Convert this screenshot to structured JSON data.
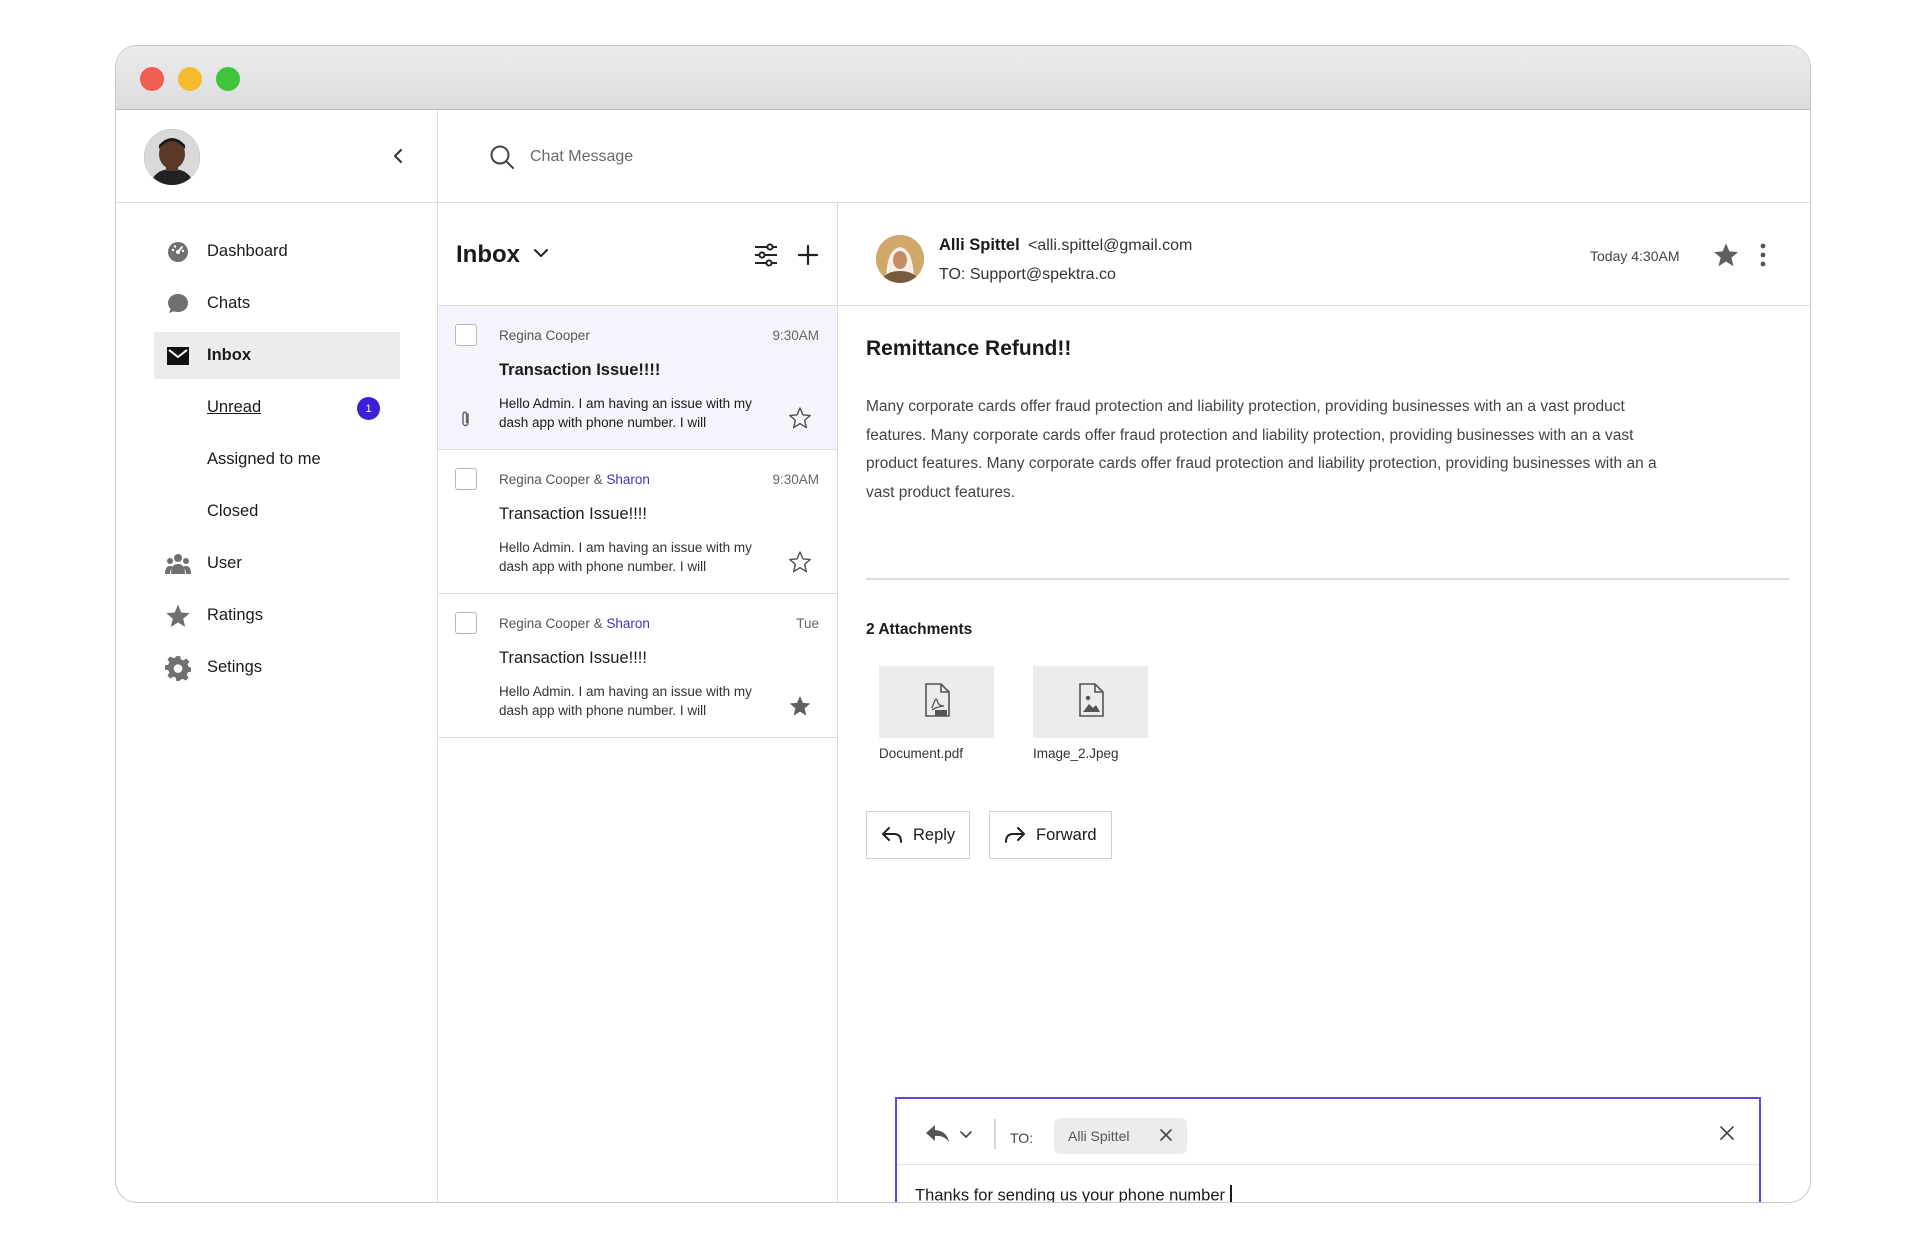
{
  "search": {
    "placeholder": "Chat Message"
  },
  "sidebar": {
    "items": [
      {
        "label": "Dashboard",
        "icon": "dashboard-icon"
      },
      {
        "label": "Chats",
        "icon": "chat-bubble-icon"
      },
      {
        "label": "Inbox",
        "icon": "envelope-icon",
        "active": true
      },
      {
        "label": "Unread",
        "badge": "1",
        "sub": true
      },
      {
        "label": "Assigned to me",
        "sub": true
      },
      {
        "label": "Closed",
        "sub": true
      },
      {
        "label": "User",
        "icon": "users-icon"
      },
      {
        "label": "Ratings",
        "icon": "star-icon"
      },
      {
        "label": "Setings",
        "icon": "gear-icon"
      }
    ]
  },
  "inbox": {
    "title": "Inbox",
    "messages": [
      {
        "from": "Regina Cooper",
        "cc": "",
        "amp": "",
        "time": "9:30AM",
        "subject": "Transaction Issue!!!!",
        "preview": "Hello Admin. I am having an issue with my dash app with phone number. I will",
        "starred": false,
        "attachment": true,
        "selected": true
      },
      {
        "from": "Regina Cooper",
        "amp": " & ",
        "cc": "Sharon",
        "time": "9:30AM",
        "subject": "Transaction Issue!!!!",
        "preview": "Hello Admin. I am having an issue with my dash app with phone number. I will",
        "starred": false,
        "attachment": false
      },
      {
        "from": "Regina Cooper",
        "amp": " & ",
        "cc": "Sharon",
        "time": "Tue",
        "subject": "Transaction Issue!!!!",
        "preview": "Hello Admin. I am having an issue with my dash app with phone number. I will",
        "starred": true,
        "attachment": false
      }
    ]
  },
  "reader": {
    "sender_name": "Alli Spittel",
    "sender_email": "<alli.spittel@gmail.com",
    "to": "TO: Support@spektra.co",
    "time": "Today 4:30AM",
    "subject": "Remittance Refund!!",
    "body": "Many corporate cards offer fraud protection and liability protection, providing businesses with an a vast product features. Many corporate cards offer fraud protection and liability protection, providing businesses with an a vast product features. Many corporate cards offer fraud protection and liability protection, providing businesses with an a vast product features.",
    "attachments_title": "2 Attachments",
    "attachments": [
      {
        "name": "Document.pdf",
        "icon": "pdf-file-icon"
      },
      {
        "name": "Image_2.Jpeg",
        "icon": "image-file-icon"
      }
    ],
    "reply_label": "Reply",
    "forward_label": "Forward"
  },
  "composer": {
    "to_label": "TO:",
    "recipient": "Alli Spittel",
    "text": "Thanks for sending us your phone number"
  },
  "colors": {
    "accent": "#3d1fd9",
    "composer_border": "#6a45d6",
    "cc_name": "#4a2bd1"
  }
}
